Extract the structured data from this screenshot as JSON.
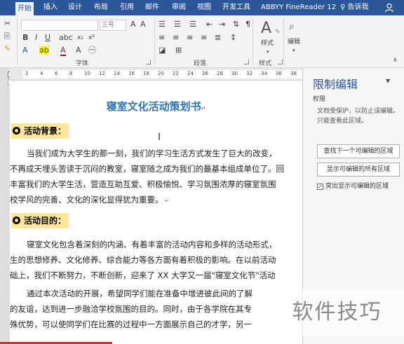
{
  "tabs": [
    "开始",
    "插入",
    "设计",
    "布局",
    "引用",
    "邮件",
    "审阅",
    "视图",
    "开发工具",
    "ABBYY FineReader 12"
  ],
  "active_tab": "开始",
  "tell_me": "告诉我",
  "ribbon": {
    "groups": [
      "字体",
      "段落",
      "样式",
      "编辑"
    ],
    "font_size_placeholder": "三号",
    "styles_label": "样式",
    "editing_label": "编辑"
  },
  "ruler": {
    "ticks": [
      "2",
      "4",
      "6",
      "8",
      "10",
      "12",
      "14",
      "16",
      "18",
      "20",
      "22",
      "24",
      "26",
      "28",
      "30",
      "32",
      "34",
      "36",
      "38"
    ]
  },
  "document": {
    "title": "寝室文化活动策划书",
    "heading1": "活动背景：",
    "para1": [
      "当我们成为大学生的那一刻，我们的学习生活方式发生了巨大的改变，",
      "不再成天埋头苦读于沉闷的教室，寝室随之成为我们的最基本组成单位了。回",
      "丰富我们的大学生活，营造互助互爱、积极愉悦、学习氛围浓厚的寝室氛围",
      "校学风的完善、文化的深化显得犹为重要。"
    ],
    "heading2": "活动目的：",
    "para2": [
      "寝室文化包含着深刻的内涵、有着丰富的活动内容和多样的活动形式，",
      "生的思想修养、文化修养、综合能力等各方面有着积极的影响。在以前活动",
      "础上，我们不断努力，不断创新，迎来了 XX 大学又一届\"寝室文化节\"活动"
    ],
    "para3": [
      "通过本次活动的开展，希望同学们能在准备中增进彼此间的了解",
      "的友谊，达到进一步融洽学校氛围的目的。同时，由于各学院在其专",
      "殊优势，可以使同学们在比赛的过程中一方面展示自己的才学，另一"
    ]
  },
  "panel": {
    "title": "限制编辑",
    "subtitle": "权限",
    "text": "文档受保护，以防止误编辑。只能查看此区域。",
    "btn_find_next": "查找下一个可编辑的区域",
    "btn_show_all": "显示可编辑的所有区域",
    "checkbox_label": "突出显示可编辑的区域",
    "checkbox_checked": true
  },
  "watermark": "软件技巧"
}
